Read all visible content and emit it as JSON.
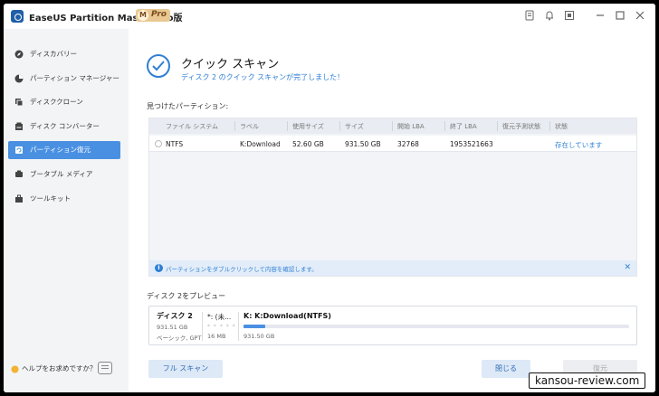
{
  "app": {
    "title": "EaseUS Partition Master Pro版",
    "badge_m": "M",
    "badge_pro": "Pro"
  },
  "titlebar_icons": [
    "note-icon",
    "bell-icon",
    "window-icon",
    "minimize-icon",
    "maximize-icon",
    "close-icon"
  ],
  "sidebar": {
    "items": [
      {
        "label": "ディスカバリー",
        "icon": "discovery-icon",
        "active": false
      },
      {
        "label": "パーティション マネージャー",
        "icon": "partition-manager-icon",
        "active": false
      },
      {
        "label": "ディスククローン",
        "icon": "disk-clone-icon",
        "active": false
      },
      {
        "label": "ディスク コンバーター",
        "icon": "disk-converter-icon",
        "active": false
      },
      {
        "label": "パーティション復元",
        "icon": "partition-recovery-icon",
        "active": true
      },
      {
        "label": "ブータブル メディア",
        "icon": "bootable-media-icon",
        "active": false
      },
      {
        "label": "ツールキット",
        "icon": "toolkit-icon",
        "active": false
      }
    ],
    "help": "ヘルプをお求めですか？"
  },
  "main": {
    "title": "クイック スキャン",
    "subtitle": "ディスク 2 のクイック スキャンが完了しました！",
    "found_label": "見つけたパーティション:",
    "table": {
      "headers": [
        "ファイル システム",
        "ラベル",
        "使用サイズ",
        "サイズ",
        "開始 LBA",
        "終了 LBA",
        "復元予測状態",
        "状態"
      ],
      "rows": [
        [
          "NTFS",
          "K:Download",
          "52.60 GB",
          "931.50 GB",
          "32768",
          "1953521663",
          "",
          "存在しています"
        ]
      ]
    },
    "info": "パーティションをダブルクリックして内容を確認します。",
    "preview_label": "ディスク 2をプレビュー",
    "disk": {
      "name": "ディスク 2",
      "size": "931.51 GB",
      "type": "ベーシック, GPT",
      "part1": {
        "label": "*: (未...",
        "size": "16 MB",
        "dots": "* * * * *"
      },
      "part2": {
        "label": "K: K:Download(NTFS)",
        "size": "931.50 GB",
        "used_fraction": 0.056
      }
    },
    "buttons": {
      "full_scan": "フル スキャン",
      "close": "閉じる",
      "restore": "復元"
    }
  },
  "watermark": "kansou-review.com",
  "colors": {
    "accent": "#4a90e2",
    "link": "#2f7fd4",
    "sidebar_bg": "#f3f4f6"
  }
}
